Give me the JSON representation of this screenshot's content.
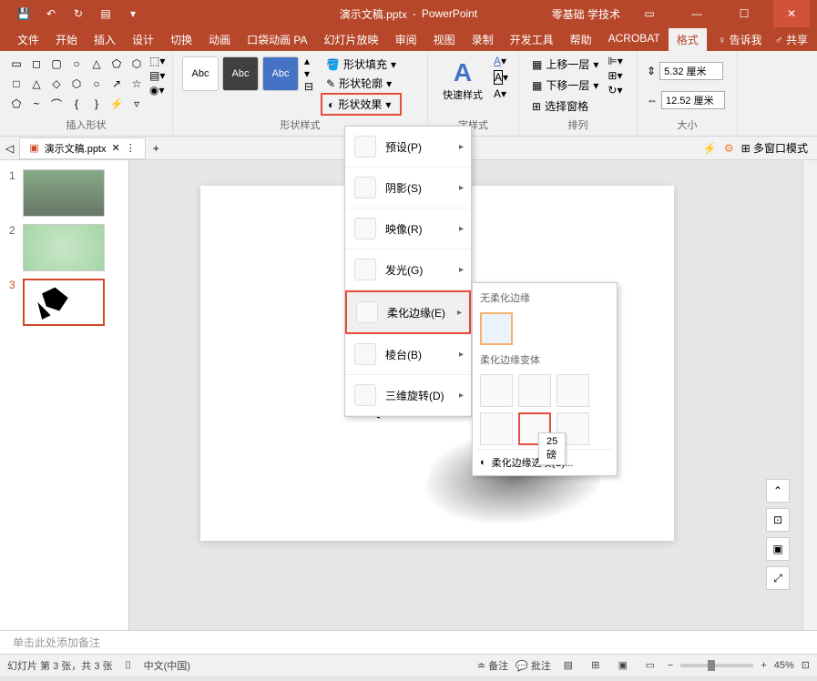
{
  "app": {
    "title_doc": "演示文稿.pptx",
    "title_app": "PowerPoint",
    "addon_label": "零基础 学技术"
  },
  "ribbon_tabs": {
    "file": "文件",
    "home": "开始",
    "insert": "插入",
    "design": "设计",
    "transitions": "切换",
    "animations": "动画",
    "pa": "口袋动画 PA",
    "slideshow": "幻灯片放映",
    "review": "审阅",
    "view": "视图",
    "record": "录制",
    "developer": "开发工具",
    "help": "帮助",
    "acrobat": "ACROBAT",
    "format": "格式",
    "tell_me": "告诉我",
    "share": "共享"
  },
  "ribbon": {
    "insert_shapes": "插入形状",
    "shape_styles": "形状样式",
    "preset_abc": "Abc",
    "shape_fill": "形状填充",
    "shape_outline": "形状轮廓",
    "shape_effects": "形状效果",
    "quick_styles": "快速样式",
    "wordart_styles": "艺术字样式",
    "bring_forward": "上移一层",
    "send_backward": "下移一层",
    "selection_pane": "选择窗格",
    "arrange": "排列",
    "size": "大小",
    "height_val": "5.32 厘米",
    "width_val": "12.52 厘米"
  },
  "doc_tab": {
    "name": "演示文稿.pptx",
    "multi_window": "多窗口模式"
  },
  "effects_menu": {
    "preset": "预设(P)",
    "shadow": "阴影(S)",
    "reflection": "映像(R)",
    "glow": "发光(G)",
    "soft_edges": "柔化边缘(E)",
    "bevel": "棱台(B)",
    "rotation_3d": "三维旋转(D)"
  },
  "soft_edges_submenu": {
    "none": "无柔化边缘",
    "variations": "柔化边缘变体",
    "tooltip": "25 磅",
    "options": "柔化边缘选项(S)..."
  },
  "slides": {
    "n1": "1",
    "n2": "2",
    "n3": "3"
  },
  "notes": {
    "placeholder": "单击此处添加备注"
  },
  "statusbar": {
    "slide_info": "幻灯片 第 3 张，共 3 张",
    "language": "中文(中国)",
    "notes_btn": "备注",
    "comments_btn": "批注",
    "zoom": "45%"
  }
}
